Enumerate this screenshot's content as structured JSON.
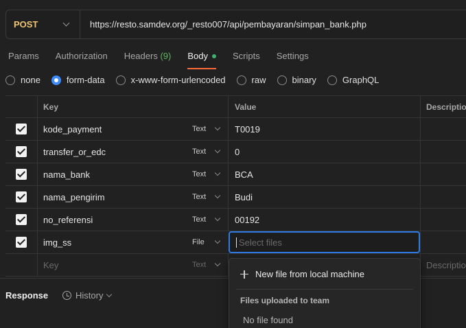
{
  "request": {
    "method": "POST",
    "url": "https://resto.samdev.org/_resto007/api/pembayaran/simpan_bank.php"
  },
  "tabs": [
    {
      "label": "Params"
    },
    {
      "label": "Authorization"
    },
    {
      "label": "Headers",
      "count": "(9)"
    },
    {
      "label": "Body",
      "active": true
    },
    {
      "label": "Scripts"
    },
    {
      "label": "Settings"
    }
  ],
  "body_modes": [
    {
      "label": "none"
    },
    {
      "label": "form-data",
      "selected": true
    },
    {
      "label": "x-www-form-urlencoded"
    },
    {
      "label": "raw"
    },
    {
      "label": "binary"
    },
    {
      "label": "GraphQL"
    }
  ],
  "table": {
    "headers": {
      "key": "Key",
      "value": "Value",
      "description": "Description"
    },
    "rows": [
      {
        "key": "kode_payment",
        "type": "Text",
        "value": "T0019"
      },
      {
        "key": "transfer_or_edc",
        "type": "Text",
        "value": "0"
      },
      {
        "key": "nama_bank",
        "type": "Text",
        "value": "BCA"
      },
      {
        "key": "nama_pengirim",
        "type": "Text",
        "value": "Budi"
      },
      {
        "key": "no_referensi",
        "type": "Text",
        "value": "00192"
      },
      {
        "key": "img_ss",
        "type": "File",
        "value_placeholder": "Select files"
      }
    ],
    "empty_row": {
      "key_placeholder": "Key",
      "type": "Text",
      "description_placeholder": "Description"
    }
  },
  "response": {
    "label": "Response",
    "history": "History"
  },
  "file_dropdown": {
    "new_file": "New file from local machine",
    "section": "Files uploaded to team",
    "empty": "No file found"
  },
  "colors": {
    "accent": "#ff6c37",
    "focus": "#2e7be6",
    "method": "#f0c674",
    "radio": "#3d8bfd"
  }
}
